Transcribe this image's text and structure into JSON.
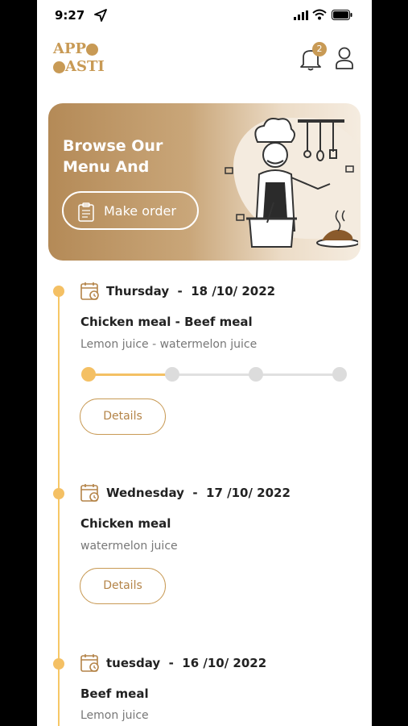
{
  "status": {
    "time": "9:27"
  },
  "logo": {
    "line1": "APP",
    "line2": "ASTI"
  },
  "header": {
    "notification_count": "2"
  },
  "banner": {
    "title": "Browse Our Menu And",
    "button_label": "Make order"
  },
  "timeline": [
    {
      "day": "Thursday",
      "date": "18 /10/ 2022",
      "meal": "Chicken meal - Beef meal",
      "juice": "Lemon juice - watermelon juice",
      "progress": 0.33,
      "details_label": "Details"
    },
    {
      "day": "Wednesday",
      "date": "17 /10/ 2022",
      "meal": "Chicken meal",
      "juice": "watermelon juice",
      "details_label": "Details"
    },
    {
      "day": "tuesday",
      "date": "16 /10/ 2022",
      "meal": "Beef meal",
      "juice": "Lemon juice"
    }
  ],
  "colors": {
    "accent": "#c89a55",
    "timeline": "#f4c064"
  }
}
